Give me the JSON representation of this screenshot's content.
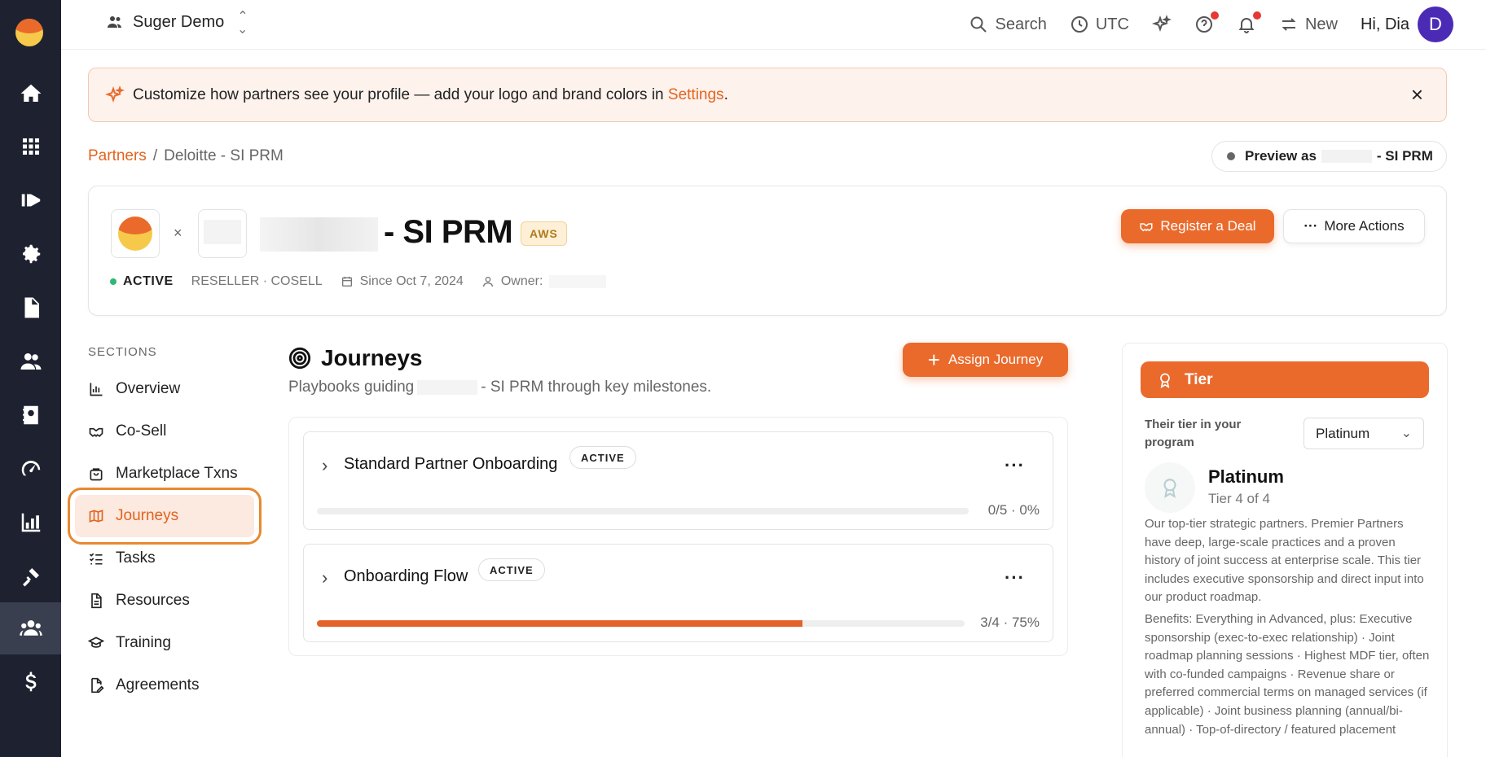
{
  "topbar": {
    "workspace": "Suger Demo",
    "search": "Search",
    "timezone": "UTC",
    "new": "New",
    "greeting": "Hi, Dia",
    "avatar_initial": "D"
  },
  "banner": {
    "text_before": "Customize how partners see your profile — add your logo and brand colors in ",
    "link": "Settings",
    "text_after": ".",
    "close": "×"
  },
  "breadcrumb": {
    "root": "Partners",
    "separator": "/",
    "current": "Deloitte - SI PRM"
  },
  "preview": {
    "label": "Preview as",
    "suffix": "- SI PRM"
  },
  "partner": {
    "times": "×",
    "title": "- SI PRM",
    "badge": "AWS",
    "status": "ACTIVE",
    "type": "RESELLER · COSELL",
    "since": "Since Oct 7, 2024",
    "owner_label": "Owner:",
    "register_deal": "Register a Deal",
    "more_actions": "More Actions",
    "more_dots": "···"
  },
  "sections": {
    "heading": "SECTIONS",
    "items": [
      {
        "label": "Overview",
        "icon": "bar-chart-icon"
      },
      {
        "label": "Co-Sell",
        "icon": "handshake-icon"
      },
      {
        "label": "Marketplace Txns",
        "icon": "shopping-bag-icon"
      },
      {
        "label": "Journeys",
        "icon": "map-icon",
        "active": true
      },
      {
        "label": "Tasks",
        "icon": "checklist-icon"
      },
      {
        "label": "Resources",
        "icon": "document-icon"
      },
      {
        "label": "Training",
        "icon": "graduation-cap-icon"
      },
      {
        "label": "Agreements",
        "icon": "signature-icon"
      }
    ]
  },
  "journeys": {
    "title": "Journeys",
    "subtitle_before": "Playbooks guiding",
    "subtitle_after": "- SI PRM through key milestones.",
    "assign": "Assign Journey",
    "assign_plus": "+",
    "items": [
      {
        "name": "Standard Partner Onboarding",
        "status": "ACTIVE",
        "progress_text": "0/5 · 0%",
        "progress": 0
      },
      {
        "name": "Onboarding Flow",
        "status": "ACTIVE",
        "progress_text": "3/4 · 75%",
        "progress": 0.75
      }
    ],
    "more": "···",
    "chevron": "›"
  },
  "tier": {
    "header": "Tier",
    "label": "Their tier in your program",
    "selected": "Platinum",
    "name": "Platinum",
    "rank": "Tier 4 of 4",
    "description": "Our top-tier strategic partners. Premier Partners have deep, large-scale practices and a proven history of joint success at enterprise scale. This tier includes executive sponsorship and direct input into our product roadmap.",
    "benefits": "Benefits: Everything in Advanced, plus: Executive sponsorship (exec-to-exec relationship) · Joint roadmap planning sessions · Highest MDF tier, often with co-funded campaigns · Revenue share or preferred commercial terms on managed services (if applicable) · Joint business planning (annual/bi-annual) · Top-of-directory / featured placement"
  },
  "colors": {
    "accent": "#ea6a2c",
    "rail": "#1e2230",
    "active_nav_bg": "#fce9e0",
    "status_green": "#2eb872"
  }
}
